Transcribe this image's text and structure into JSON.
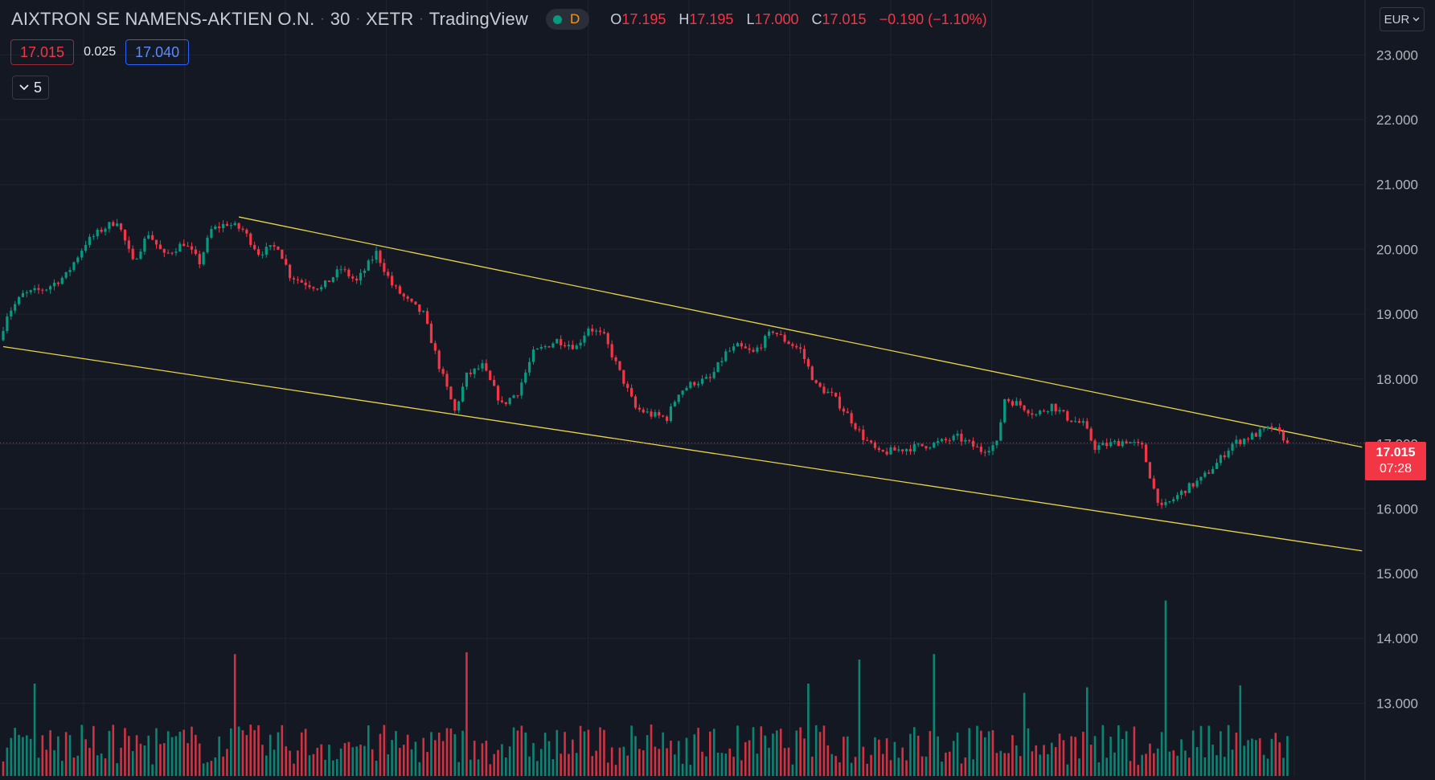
{
  "legend": {
    "symbol": "AIXTRON SE NAMENS-AKTIEN O.N.",
    "interval": "30",
    "exchange": "XETR",
    "provider": "TradingView",
    "status_letter": "D",
    "open_label": "O",
    "open": "17.195",
    "high_label": "H",
    "high": "17.195",
    "low_label": "L",
    "low": "17.000",
    "close_label": "C",
    "close": "17.015",
    "change": "−0.190 (−1.10%)"
  },
  "quote": {
    "bid": "17.015",
    "spread": "0.025",
    "ask": "17.040"
  },
  "indicators_toggle": {
    "count": "5"
  },
  "currency": "EUR",
  "last_price": {
    "price": "17.015",
    "countdown": "07:28"
  },
  "colors": {
    "background": "#141822",
    "grid": "#1f2430",
    "up": "#089981",
    "down": "#f23645",
    "trendline": "#e8d44d",
    "axis_text": "#b2b5be",
    "last_price": "#f23645"
  },
  "chart_data": {
    "type": "candlestick",
    "ylim": [
      12.25,
      23.35
    ],
    "y_ticks": [
      "23.000",
      "22.000",
      "21.000",
      "20.000",
      "19.000",
      "18.000",
      "17.000",
      "16.000",
      "15.000",
      "14.000",
      "13.000"
    ],
    "bar_count": 220,
    "price_path": [
      [
        0,
        18.6
      ],
      [
        2,
        19.0
      ],
      [
        6,
        19.3
      ],
      [
        12,
        19.4
      ],
      [
        17,
        19.6
      ],
      [
        22,
        20.1
      ],
      [
        26,
        20.3
      ],
      [
        30,
        20.45
      ],
      [
        34,
        19.8
      ],
      [
        38,
        20.25
      ],
      [
        42,
        19.9
      ],
      [
        47,
        20.1
      ],
      [
        51,
        19.8
      ],
      [
        54,
        20.3
      ],
      [
        58,
        20.4
      ],
      [
        62,
        20.3
      ],
      [
        66,
        19.95
      ],
      [
        71,
        20.05
      ],
      [
        74,
        19.6
      ],
      [
        77,
        19.5
      ],
      [
        82,
        19.4
      ],
      [
        87,
        19.7
      ],
      [
        91,
        19.5
      ],
      [
        96,
        19.95
      ],
      [
        100,
        19.45
      ],
      [
        104,
        19.2
      ],
      [
        108,
        19.0
      ],
      [
        112,
        18.2
      ],
      [
        116,
        17.5
      ],
      [
        119,
        18.05
      ],
      [
        123,
        18.2
      ],
      [
        128,
        17.6
      ],
      [
        132,
        17.8
      ],
      [
        136,
        18.4
      ],
      [
        142,
        18.6
      ],
      [
        147,
        18.5
      ],
      [
        150,
        18.8
      ],
      [
        154,
        18.65
      ],
      [
        158,
        18.1
      ],
      [
        162,
        17.55
      ],
      [
        166,
        17.45
      ],
      [
        170,
        17.4
      ],
      [
        173,
        17.8
      ],
      [
        177,
        17.95
      ],
      [
        181,
        18.0
      ],
      [
        185,
        18.4
      ],
      [
        188,
        18.5
      ],
      [
        192,
        18.4
      ],
      [
        197,
        18.75
      ],
      [
        200,
        18.6
      ],
      [
        204,
        18.45
      ],
      [
        208,
        17.9
      ],
      [
        212,
        17.75
      ],
      [
        216,
        17.45
      ],
      [
        220,
        17.1
      ],
      [
        224,
        16.85
      ],
      [
        228,
        16.9
      ],
      [
        233,
        16.95
      ],
      [
        238,
        17.0
      ],
      [
        244,
        17.1
      ],
      [
        250,
        16.9
      ],
      [
        254,
        17.0
      ],
      [
        256,
        17.7
      ],
      [
        260,
        17.6
      ],
      [
        264,
        17.45
      ],
      [
        268,
        17.6
      ],
      [
        272,
        17.4
      ],
      [
        276,
        17.3
      ],
      [
        279,
        16.95
      ],
      [
        283,
        17.0
      ],
      [
        287,
        17.05
      ],
      [
        291,
        16.95
      ],
      [
        294,
        16.3
      ],
      [
        296,
        16.0
      ],
      [
        298,
        16.1
      ],
      [
        302,
        16.3
      ],
      [
        306,
        16.45
      ],
      [
        310,
        16.7
      ],
      [
        314,
        17.0
      ],
      [
        318,
        17.1
      ],
      [
        324,
        17.25
      ],
      [
        327,
        17.1
      ]
    ],
    "volume_spikes": [
      [
        8,
        0.5
      ],
      [
        59,
        0.66
      ],
      [
        118,
        0.67
      ],
      [
        205,
        0.5
      ],
      [
        218,
        0.63
      ],
      [
        237,
        0.66
      ],
      [
        260,
        0.45
      ],
      [
        276,
        0.48
      ],
      [
        296,
        0.95
      ],
      [
        315,
        0.49
      ]
    ],
    "trendlines": [
      {
        "name": "upper-channel",
        "from": [
          60,
          20.5
        ],
        "to": [
          346,
          16.95
        ]
      },
      {
        "name": "lower-channel",
        "from": [
          0,
          18.5
        ],
        "to": [
          346,
          15.35
        ]
      }
    ]
  }
}
